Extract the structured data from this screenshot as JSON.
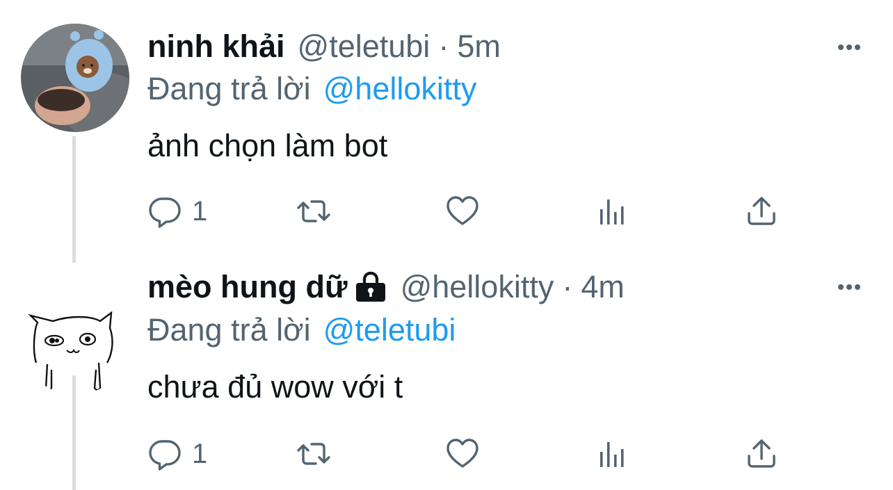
{
  "tweets": [
    {
      "display_name": "ninh khải",
      "handle": "@teletubi",
      "separator": "·",
      "time": "5m",
      "replying_prefix": "Đang trả lời",
      "replying_to": "@hellokitty",
      "text": "ảnh chọn làm bot",
      "reply_count": "1",
      "protected": false
    },
    {
      "display_name": "mèo hung dữ",
      "handle": "@hellokitty",
      "separator": "·",
      "time": "4m",
      "replying_prefix": "Đang trả lời",
      "replying_to": "@teletubi",
      "text": "chưa đủ wow với t",
      "reply_count": "1",
      "protected": true
    }
  ],
  "icons": {
    "more": "more-horizontal-icon",
    "reply": "speech-bubble-icon",
    "retweet": "retweet-arrows-icon",
    "like": "heart-icon",
    "views": "bar-chart-icon",
    "share": "share-upload-icon",
    "protected": "lock-icon"
  },
  "colors": {
    "text_primary": "#0f1419",
    "text_secondary": "#536471",
    "mention": "#1d9bf0",
    "thread_line": "#dadee1"
  }
}
